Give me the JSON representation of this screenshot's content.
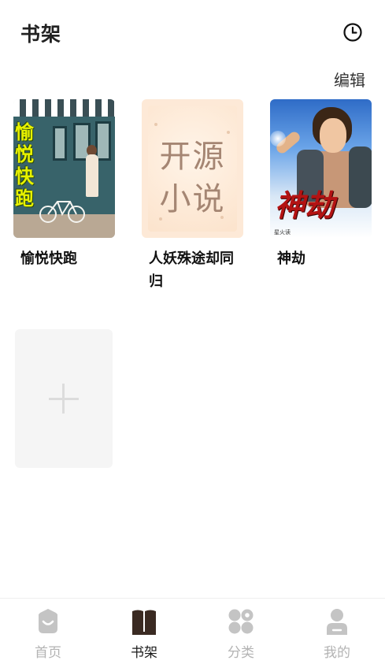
{
  "header": {
    "title": "书架",
    "history_icon": "clock-icon"
  },
  "toolbar": {
    "edit_label": "编辑"
  },
  "books": [
    {
      "title": "愉悦快跑",
      "cover_text": "愉悦快跑"
    },
    {
      "title": "人妖殊途却同归",
      "cover_text_line1": "开源",
      "cover_text_line2": "小说"
    },
    {
      "title": "神劫",
      "cover_text": "神劫",
      "cover_author": "星火读"
    }
  ],
  "add_book": {
    "icon": "plus-icon"
  },
  "tabbar": {
    "items": [
      {
        "label": "首页",
        "icon": "home-icon",
        "active": false
      },
      {
        "label": "书架",
        "icon": "book-icon",
        "active": true
      },
      {
        "label": "分类",
        "icon": "category-icon",
        "active": false
      },
      {
        "label": "我的",
        "icon": "user-icon",
        "active": false
      }
    ]
  },
  "colors": {
    "active_tab": "#1b1b1b",
    "inactive_tab": "#b3b3b3",
    "accent_brown": "#3a2a22"
  }
}
